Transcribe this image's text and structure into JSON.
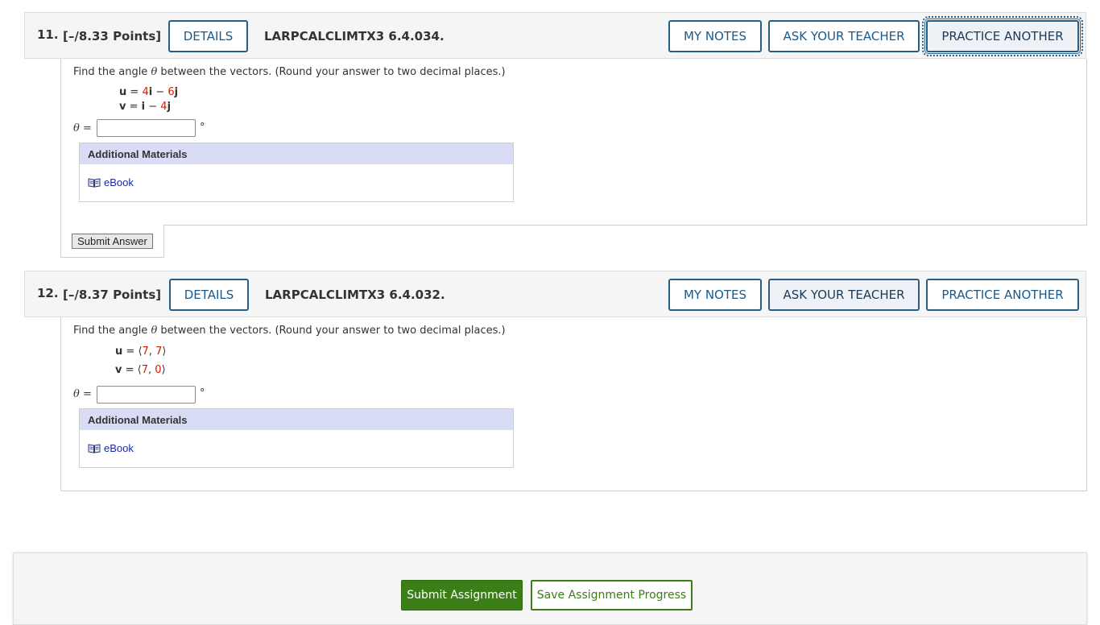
{
  "questions": [
    {
      "number": "11.",
      "points": "[–/8.33 Points]",
      "details_label": "DETAILS",
      "reference": "LARPCALCLIMTX3 6.4.034.",
      "my_notes_label": "MY NOTES",
      "ask_teacher_label": "ASK YOUR TEACHER",
      "practice_label": "PRACTICE ANOTHER",
      "prompt_pre": "Find the angle ",
      "theta": "θ",
      "prompt_post": " between the vectors. (Round your answer to two decimal places.)",
      "vectors": [
        {
          "name": "u",
          "eq": " = ",
          "c1": "4",
          "b1": "i",
          "op": " − ",
          "c2": "6",
          "b2": "j"
        },
        {
          "name": "v",
          "eq": " = ",
          "c1": "",
          "b1": "i",
          "op": " − ",
          "c2": "4",
          "b2": "j"
        }
      ],
      "answer_label": "θ =",
      "answer_value": "",
      "unit": "°",
      "additional_materials": "Additional Materials",
      "ebook_label": "eBook",
      "submit_answer_label": "Submit Answer"
    },
    {
      "number": "12.",
      "points": "[–/8.37 Points]",
      "details_label": "DETAILS",
      "reference": "LARPCALCLIMTX3 6.4.032.",
      "my_notes_label": "MY NOTES",
      "ask_teacher_label": "ASK YOUR TEACHER",
      "practice_label": "PRACTICE ANOTHER",
      "prompt_pre": "Find the angle ",
      "theta": "θ",
      "prompt_post": " between the vectors. (Round your answer to two decimal places.)",
      "vectors": [
        {
          "name": "u",
          "eq": " = ",
          "open": "⟨",
          "a": "7",
          "sep": ", ",
          "b": "7",
          "close": "⟩"
        },
        {
          "name": "v",
          "eq": " = ",
          "open": "⟨",
          "a": "7",
          "sep": ", ",
          "b": "0",
          "close": "⟩"
        }
      ],
      "answer_label": "θ =",
      "answer_value": "",
      "unit": "°",
      "additional_materials": "Additional Materials",
      "ebook_label": "eBook"
    }
  ],
  "footer": {
    "submit_label": "Submit Assignment",
    "save_label": "Save Assignment Progress"
  },
  "colors": {
    "header_button_border": "#2a5d84",
    "highlight_red": "#cc2200",
    "materials_header_bg": "#d8ddf5",
    "submit_green": "#3b7d16"
  },
  "icons": [
    "book-icon"
  ]
}
